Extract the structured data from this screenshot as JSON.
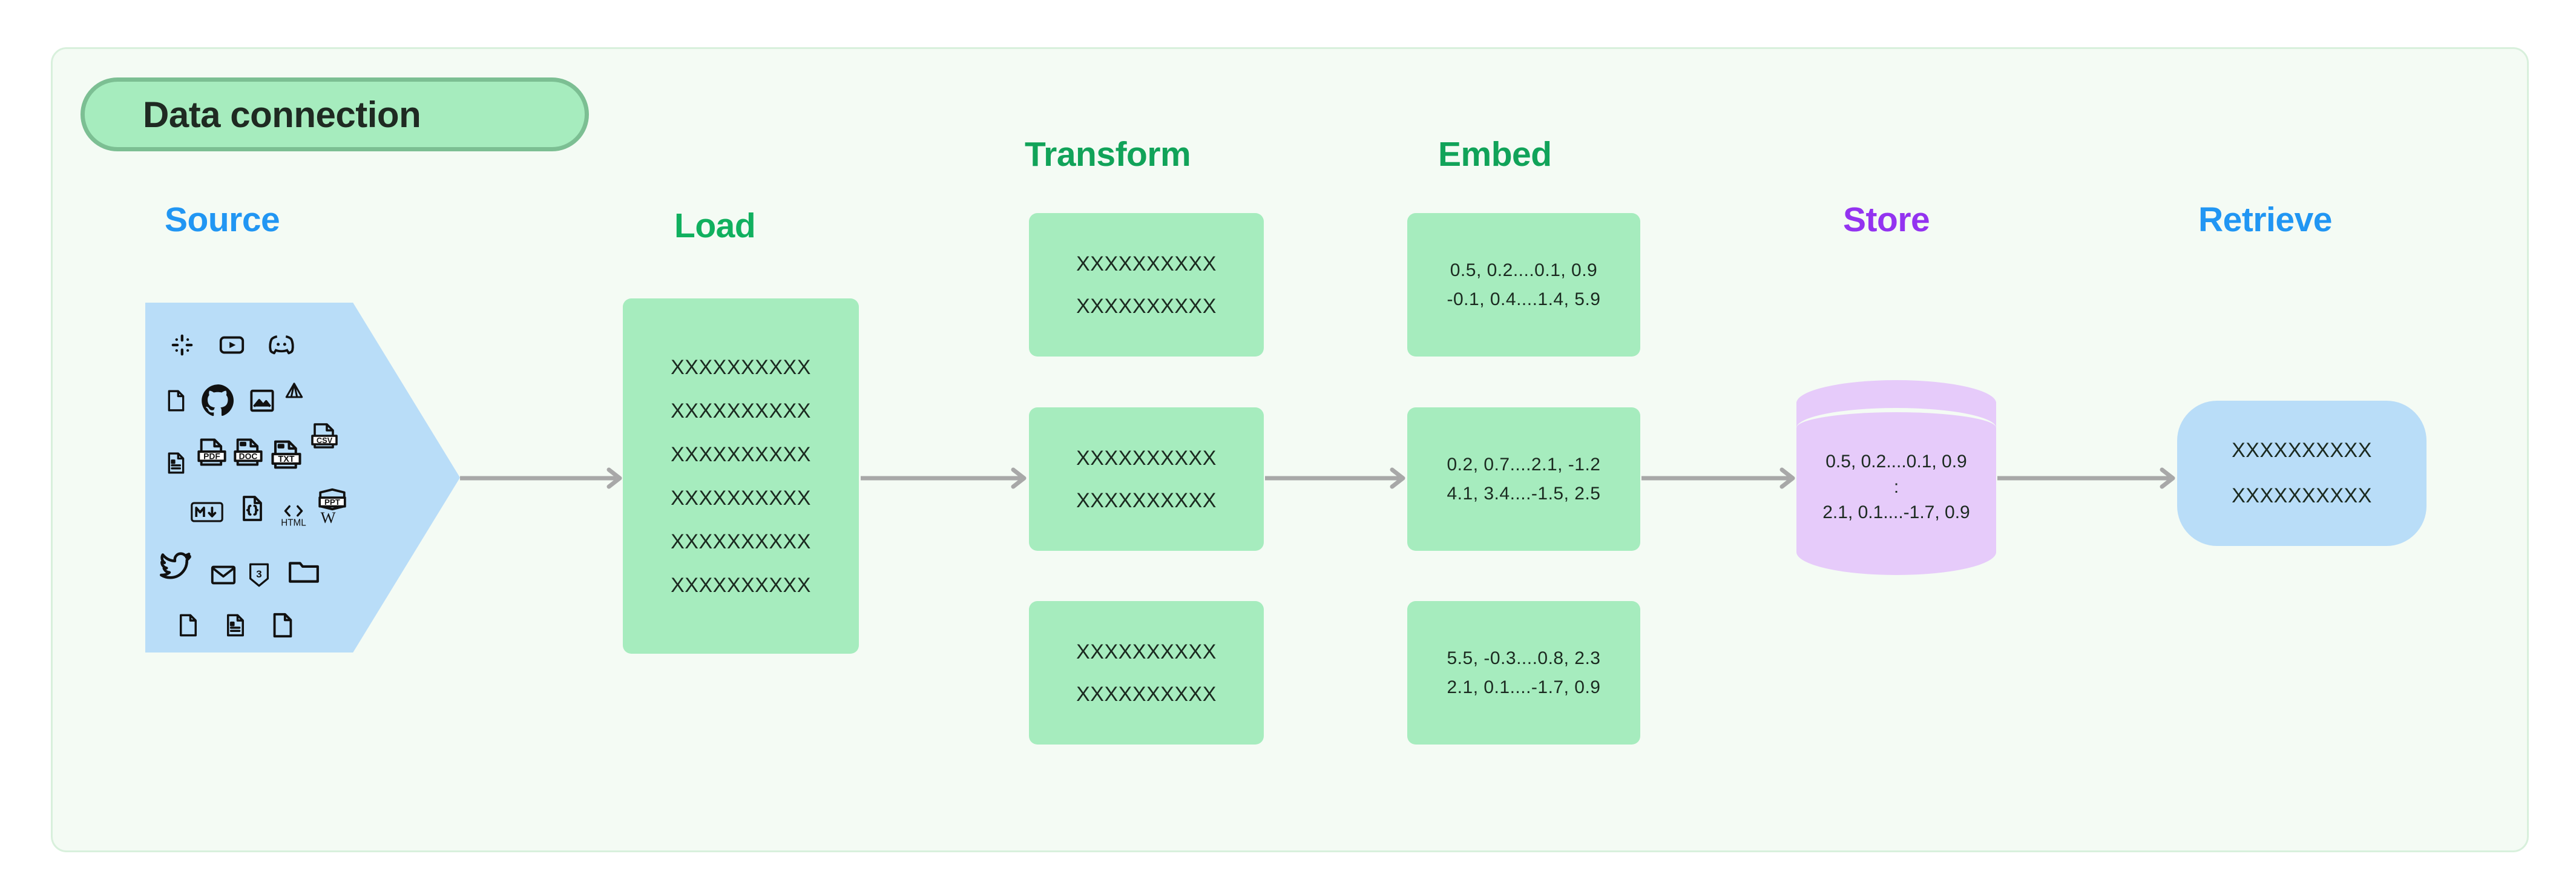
{
  "frame": {
    "background": "#f4fbf4",
    "border_color": "#d8f0dc"
  },
  "title": {
    "label": "Data connection",
    "fill": "#a6ecbe",
    "border": "#7cbf93",
    "text_color": "#1f2a22"
  },
  "stages": {
    "source": {
      "label": "Source",
      "color": "#2196f3"
    },
    "load": {
      "label": "Load",
      "color": "#11b05f"
    },
    "transform": {
      "label": "Transform",
      "color": "#11a359"
    },
    "embed": {
      "label": "Embed",
      "color": "#11a359"
    },
    "store": {
      "label": "Store",
      "color": "#9333f0"
    },
    "retrieve": {
      "label": "Retrieve",
      "color": "#2196f3"
    }
  },
  "source": {
    "shape_fill": "#b9ddf8",
    "icon_rows": [
      [
        "slack-icon",
        "youtube-icon",
        "discord-icon"
      ],
      [
        "document-icon",
        "github-icon",
        "image-icon",
        "google-drive-icon"
      ],
      [
        "document-lines-icon",
        "pdf-file-icon",
        "doc-file-icon",
        "txt-file-icon",
        "ppt-file-icon"
      ],
      [
        "markdown-icon",
        "json-code-file-icon",
        "html-icon",
        "wikipedia-icon"
      ],
      [
        "twitter-icon",
        "email-icon",
        "css3-icon",
        "folder-icon"
      ],
      [
        "document-icon",
        "document-lines-icon",
        "document-icon"
      ]
    ],
    "csv_label": "CSV",
    "pdf_label": "PDF",
    "doc_label": "DOC",
    "txt_label": "TXT",
    "ppt_label": "PPT",
    "html_label": "HTML",
    "markdown_label": "M",
    "wikipedia_label": "W",
    "css3_label": "3"
  },
  "load": {
    "fill": "#a6ecbe",
    "lines": [
      "XXXXXXXXXX",
      "XXXXXXXXXX",
      "XXXXXXXXXX",
      "XXXXXXXXXX",
      "XXXXXXXXXX",
      "XXXXXXXXXX"
    ]
  },
  "transform": {
    "fill": "#a6ecbe",
    "boxes": [
      {
        "lines": [
          "XXXXXXXXXX",
          "XXXXXXXXXX"
        ]
      },
      {
        "lines": [
          "XXXXXXXXXX",
          "XXXXXXXXXX"
        ]
      },
      {
        "lines": [
          "XXXXXXXXXX",
          "XXXXXXXXXX"
        ]
      }
    ]
  },
  "embed": {
    "fill": "#a6ecbe",
    "boxes": [
      {
        "lines": [
          "0.5, 0.2....0.1, 0.9",
          "-0.1, 0.4....1.4, 5.9"
        ]
      },
      {
        "lines": [
          "0.2, 0.7....2.1, -1.2",
          "4.1, 3.4....-1.5, 2.5"
        ]
      },
      {
        "lines": [
          "5.5, -0.3....0.8, 2.3",
          "2.1, 0.1....-1.7, 0.9"
        ]
      }
    ]
  },
  "store": {
    "fill": "#e6cbfa",
    "lines": [
      "0.5, 0.2....0.1, 0.9",
      ":",
      "2.1, 0.1....-1.7, 0.9"
    ]
  },
  "retrieve": {
    "fill": "#b9ddf8",
    "lines": [
      "XXXXXXXXXX",
      "XXXXXXXXXX"
    ]
  },
  "arrows": {
    "color": "#a8a8a8",
    "count": 5
  }
}
